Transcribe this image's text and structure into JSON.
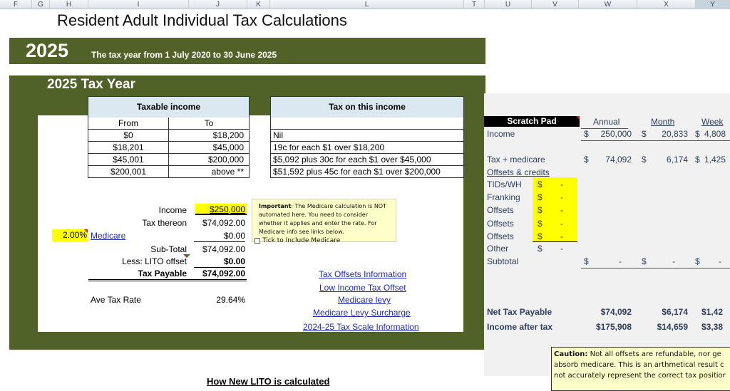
{
  "columns": [
    "F",
    "G",
    "H",
    "I",
    "J",
    "K",
    "L",
    "T",
    "U",
    "V",
    "W",
    "X",
    "Y"
  ],
  "selected_column": "Y",
  "title": "Resident Adult Individual Tax Calculations",
  "year_banner": {
    "year": "2025",
    "subtitle": "The tax year from 1 July 2020 to 30 June 2025"
  },
  "panel": {
    "title": "2025 Tax Year",
    "taxable_income": {
      "header": "Taxable income",
      "col_from": "From",
      "col_to": "To",
      "rows": [
        {
          "from": "$0",
          "to": "$18,200"
        },
        {
          "from": "$18,201",
          "to": "$45,000"
        },
        {
          "from": "$45,001",
          "to": "$200,000"
        },
        {
          "from": "$200,001",
          "to": "above **"
        }
      ]
    },
    "tax_on_income": {
      "header": "Tax on this income",
      "rows": [
        "Nil",
        "19c for each $1 over $18,200",
        "$5,092 plus 30c for each $1 over $45,000",
        "$51,592 plus 45c for each $1 over $200,000"
      ]
    },
    "calc": {
      "income_label": "Income",
      "income_value": "$250,000",
      "tax_thereon_label": "Tax thereon",
      "tax_thereon_value": "$74,092.00",
      "medicare_rate": "2.00%",
      "medicare_label": "Medicare",
      "medicare_value": "$0.00",
      "subtotal_label": "Sub-Total",
      "subtotal_value": "$74,092.00",
      "lito_label": "Less: LITO offset",
      "lito_value": "$0.00",
      "tax_payable_label": "Tax Payable",
      "tax_payable_value": "$74,092.00",
      "ave_rate_label": "Ave Tax Rate",
      "ave_rate_value": "29.64%"
    },
    "note": {
      "bold": "Important",
      "text": ": The Medicare calculation is  NOT automated here.  You need to consider whether it applies and enter the rate.  For Medicare info see links below.",
      "checkbox_label": "Tick to Include Medicare",
      "checked": false
    },
    "links": [
      "Tax Offsets Information",
      "Low Income Tax Offset",
      "Medicare levy",
      "Medicare Levy Surcharge",
      "2024-25 Tax Scale Information"
    ]
  },
  "scratch_pad": {
    "title": "Scratch Pad",
    "headers": [
      "Annual",
      "Month",
      "Week"
    ],
    "income_label": "Income",
    "income": [
      "250,000",
      "20,833",
      "4,808"
    ],
    "tax_label": "Tax + medicare",
    "tax": [
      "74,092",
      "6,174",
      "1,425"
    ],
    "offsets_label": "Offsets & credits",
    "offset_items": [
      {
        "label": "TIDs/WH",
        "value": "-"
      },
      {
        "label": "Franking",
        "value": "-"
      },
      {
        "label": "Offsets",
        "value": "-"
      },
      {
        "label": "Offsets",
        "value": "-"
      },
      {
        "label": "Offsets",
        "value": "-"
      },
      {
        "label": "Other",
        "value": "-"
      }
    ],
    "subtotal_label": "Subtotal",
    "subtotal": [
      "-",
      "-",
      "-"
    ],
    "net_tax_label": "Net Tax Payable",
    "net_tax": [
      "$74,092",
      "$6,174",
      "$1,42"
    ],
    "after_tax_label": "Income after tax",
    "after_tax": [
      "$175,908",
      "$14,659",
      "$3,38"
    ],
    "currency": "$"
  },
  "caution": {
    "bold": "Caution:",
    "lines": [
      " Not all offsets are refundable, nor ge",
      "absorb medicare. This is an arthmetical result c",
      "not accurately represent the correct tax positior"
    ]
  },
  "lito_heading": "How New LITO is calculated"
}
